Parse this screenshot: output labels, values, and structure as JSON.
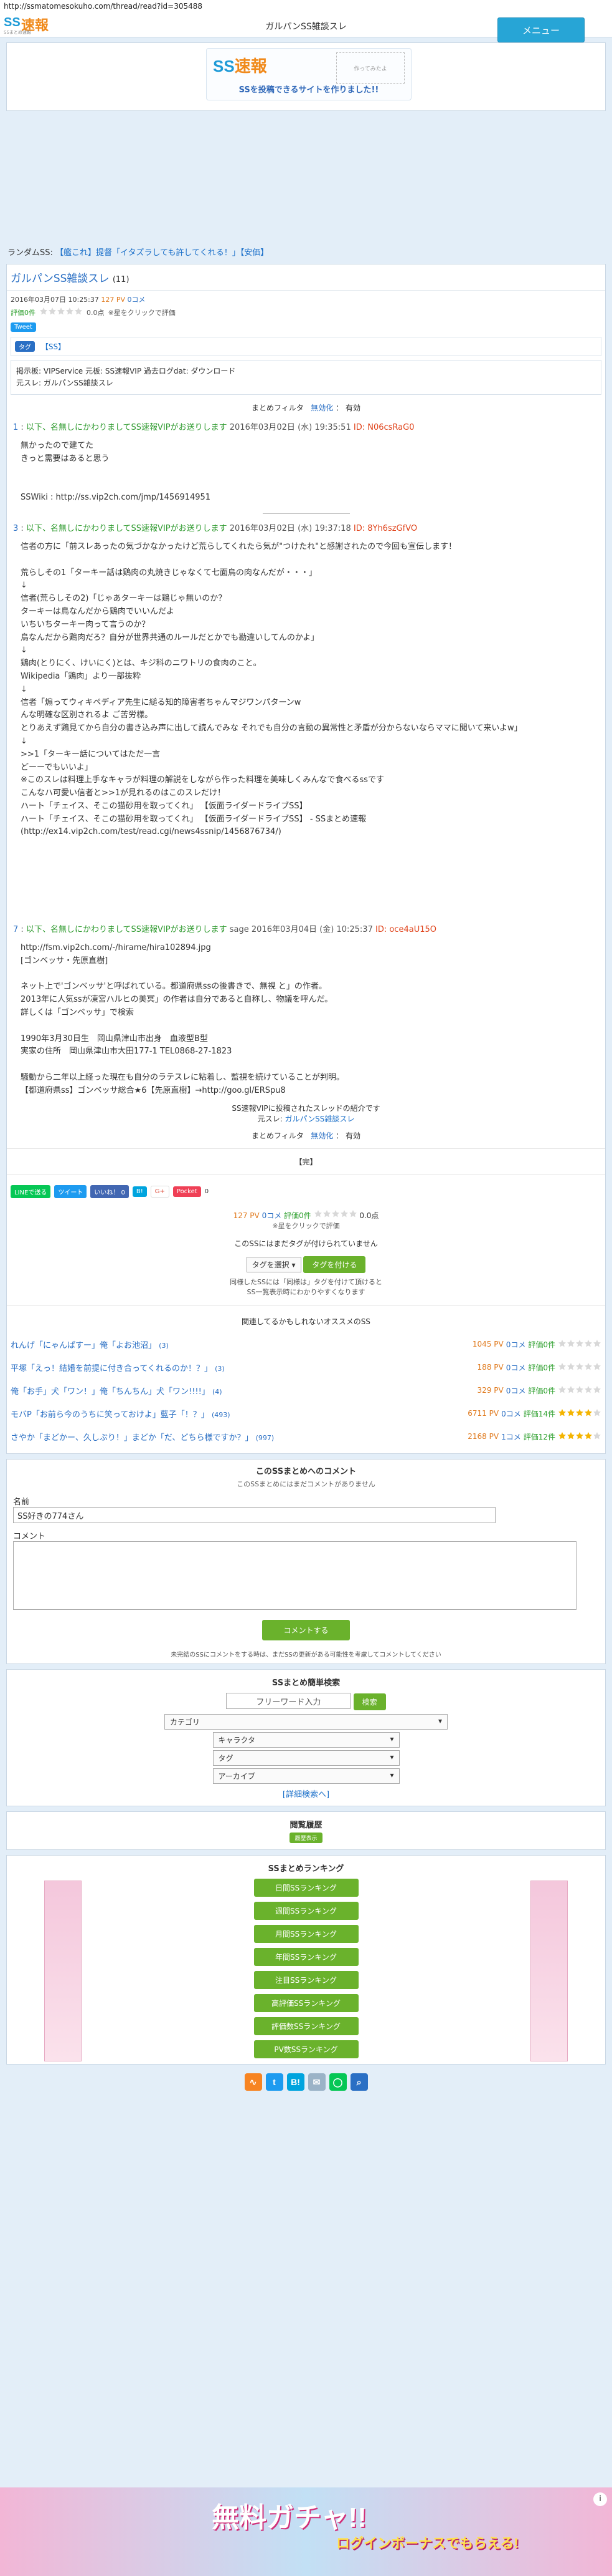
{
  "url": "http://ssmatomesokuho.com/thread/read?id=305488",
  "header": {
    "title": "ガルパンSS雑談スレ",
    "menu_label": "メニュー",
    "logo_ss": "SS",
    "logo_main": "速報",
    "logo_sub": "SSまとめ速報"
  },
  "banner": {
    "logo_ss": "SS",
    "logo_main": "速報",
    "cta": "SSを投稿できるサイトを作りました!!",
    "sketch": "作ってみたよ"
  },
  "random": {
    "label": "ランダムSS:",
    "link": "【艦これ】提督「イタズラしても許してくれる！」【安価】"
  },
  "article": {
    "title": "ガルパンSS雑談スレ",
    "count": "(11)",
    "date": "2016年03月07日 10:25:37",
    "pv": "127 PV",
    "comments": "0コメ",
    "rate_label": "評価0件",
    "rate_value": "0.0点",
    "rate_note": "※星をクリックで評価",
    "tweet": "Tweet",
    "tag_chip": "タグ",
    "tag": "【SS】",
    "info_lines": [
      "掲示板: VIPService 元板: SS速報VIP 過去ログdat: ダウンロード",
      "元スレ: ガルパンSS雑談スレ"
    ],
    "filter_label": "まとめフィルタ",
    "filter_state": "無効化",
    "filter_sep": "：",
    "filter_value": "有効"
  },
  "posts": [
    {
      "head_num": "1",
      "head_name": "以下、名無しにかわりましてSS速報VIPがお送りします",
      "head_date": "2016年03月02日 (水) 19:35:51",
      "head_id": "ID: N06csRaG0",
      "body": "無かったので建てた\nきっと需要はあると思う\n\n\nSSWiki : http://ss.vip2ch.com/jmp/1456914951"
    },
    {
      "head_num": "3",
      "head_name": "以下、名無しにかわりましてSS速報VIPがお送りします",
      "head_date": "2016年03月02日 (水) 19:37:18",
      "head_id": "ID: 8Yh6szGfVO",
      "body": "信者の方に「前スレあったの気づかなかったけど荒らしてくれたら気が\"つけたれ\"と感謝されたので今回も宣伝します！\n\n荒らしその1「ターキー話は鶏肉の丸焼きじゃなくて七面鳥の肉なんだが・・・」\n↓\n信者(荒らしその2)「じゃあターキーは鶏じゃ無いのか？\nターキーは鳥なんだから鶏肉でいいんだよ\nいちいちターキー肉って言うのか？\n鳥なんだから鶏肉だろ？自分が世界共通のルールだとかでも勘違いしてんのかよ」\n↓\n鶏肉(とりにく、けいにく)とは、キジ科のニワトリの食肉のこと。\nWikipedia「鶏肉」より一部抜粋\n↓\n信者「煽ってウィキペディア先生に縋る知的障害者ちゃんマジワンパターンw\nんな明確な区別されるよ ご苦労様。\nとりあえず鶏見てから自分の書き込み声に出して読んでみな それでも自分の言動の異常性と矛盾が分からないならママに聞いて来いよw」\n↓\n>>1「ターキー話についてはただ一言\nどーーでもいいよ」\n※このスレは料理上手なキャラが料理の解説をしながら作った料理を美味しくみんなで食べるssです\nこんなハ可愛い信者と>>1が見れるのはこのスレだけ！\nハート「チェイス、そこの猫砂用を取ってくれ」 【仮面ライダードライブSS】\nハート「チェイス、そこの猫砂用を取ってくれ」 【仮面ライダードライブSS】 - SSまとめ速報\n(http://ex14.vip2ch.com/test/read.cgi/news4ssnip/1456876734/)"
    },
    {
      "head_num": "7",
      "head_name": "以下、名無しにかわりましてSS速報VIPがお送りします",
      "head_date": "sage 2016年03月04日 (金) 10:25:37",
      "head_id": "ID: oce4aU15O",
      "body": "http://fsm.vip2ch.com/-/hirame/hira102894.jpg\n[ゴンベッサ・先原直樹]\n\nネット上で'ゴンベッサ'と呼ばれている。都道府県ssの後書きで、無視 と」の作者。\n2013年に人気ssが凍宮ハルヒの美冥」の作者は自分であると自称し、物議を呼んだ。\n詳しくは「ゴンベッサ」で検索\n\n1990年3月30日生　岡山県津山市出身　血液型B型\n実家の住所　岡山県津山市大田177-1 TEL0868-27-1823\n\n騒動から二年以上経った現在も自分のラテスレに粘着し、監視を続けていることが判明。\n【都道府県ss】ゴンベッサ総合★6【先原直樹】→http://goo.gl/ERSpu8"
    }
  ],
  "after_posts": {
    "line1": "SS速報VIPに投稿されたスレッドの紹介です",
    "line2_prefix": "元スレ: ",
    "line2_link": "ガルパンSS雑談スレ",
    "filter_label": "まとめフィルタ",
    "filter_state": "無効化",
    "filter_sep": "：",
    "filter_value": "有効",
    "close": "【完】"
  },
  "share": {
    "line": "LINEで送る",
    "tweet": "ツイート",
    "like": "いいね！ 0",
    "hatena": "B!",
    "google": "G+",
    "pocket": "Pocket",
    "count": "0"
  },
  "rating_block": {
    "pv": "127 PV",
    "comments": "0コメ",
    "rate_label": "評価0件",
    "rate_value": "0.0点",
    "note": "※星をクリックで評価",
    "no_tag": "このSSにはまだタグが付けられていません",
    "tag_select": "タグを選択",
    "tag_button": "タグを付ける",
    "note1": "同様したSSには「同様は」タグを付けて頂けると",
    "note2": "SS一覧表示時にわかりやすくなります"
  },
  "recommend": {
    "title": "関連してるかもしれないオススメのSS",
    "items": [
      {
        "title": "れんげ「にゃんぱすー」俺「よお池沼」",
        "count": "(3)",
        "pv": "1045 PV",
        "cm": "0コメ",
        "rate": "評価0件",
        "stars": 0
      },
      {
        "title": "平塚「えっ！結婚を前提に付き合ってくれるのか！？」",
        "count": "(3)",
        "pv": "188 PV",
        "cm": "0コメ",
        "rate": "評価0件",
        "stars": 0
      },
      {
        "title": "俺「お手」犬「ワン！」俺「ちんちん」犬「ワン!!!!」",
        "count": "(4)",
        "pv": "329 PV",
        "cm": "0コメ",
        "rate": "評価0件",
        "stars": 0
      },
      {
        "title": "モバP「お前ら今のうちに笑っておけよ」藍子「！？」",
        "count": "(493)",
        "pv": "6711 PV",
        "cm": "0コメ",
        "rate": "評価14件",
        "stars": 4
      },
      {
        "title": "さやか「まどかー、久しぶり！」まどか「だ、どちら様ですか？」",
        "count": "(997)",
        "pv": "2168 PV",
        "cm": "1コメ",
        "rate": "評価12件",
        "stars": 4
      }
    ]
  },
  "comment_box": {
    "title": "このSSまとめへのコメント",
    "sub": "このSSまとめにはまだコメントがありません",
    "name_label": "名前",
    "name_value": "SS好きの774さん",
    "comment_label": "コメント",
    "submit": "コメントする",
    "note": "未完結のSSにコメントをする時は、まだSSの更新がある可能性を考慮してコメントしてください"
  },
  "search": {
    "title": "SSまとめ簡単検索",
    "placeholder": "フリーワード入力",
    "button": "検索",
    "category": "カテゴリ",
    "character": "キャラクタ",
    "tag": "タグ",
    "archive": "アーカイブ",
    "detail": "[詳細検索へ]"
  },
  "history": {
    "title": "閲覧履歴",
    "button": "履歴表示"
  },
  "ranking": {
    "title": "SSまとめランキング",
    "items": [
      "日間SSランキング",
      "週間SSランキング",
      "月間SSランキング",
      "年間SSランキング",
      "注目SSランキング",
      "高評価SSランキング",
      "評価数SSランキング",
      "PV数SSランキング"
    ]
  },
  "bottom_icons": [
    "RSS",
    "Twitter",
    "Hatena",
    "Mail",
    "LINE",
    "Search"
  ],
  "bottom_ad": {
    "main": "無料ガチャ!!",
    "sub": "ログインボーナスでもらえる!"
  },
  "colors": {
    "accent": "#27a5d6",
    "link": "#2a6fc4",
    "green": "#6ab22c",
    "orange": "#e07a1e"
  }
}
